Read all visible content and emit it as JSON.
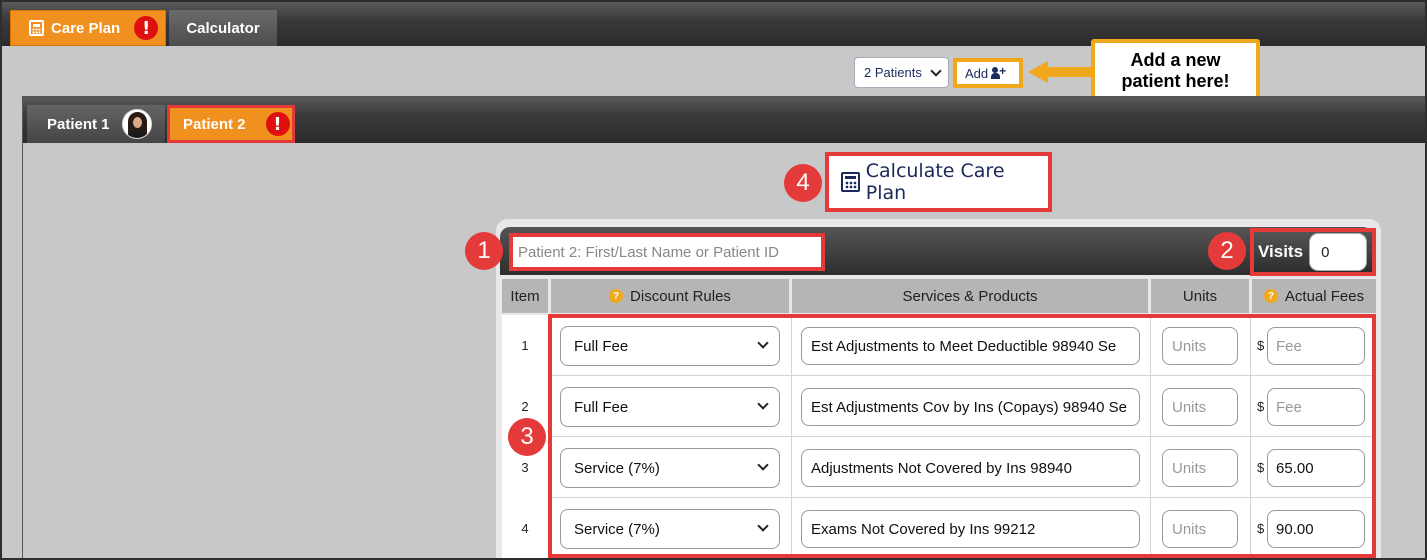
{
  "colors": {
    "accent_orange": "#f0901f",
    "highlight_red": "#e53a3a",
    "callout_yellow": "#f2a81d",
    "dark_bar": "#2d2d2d"
  },
  "top_tabs": [
    {
      "label": "Care Plan",
      "icon": "calculator-icon",
      "alert": "!"
    },
    {
      "label": "Calculator"
    }
  ],
  "patients_select": {
    "value": "2 Patients"
  },
  "add_button": {
    "label": "Add",
    "icon": "user-plus-icon"
  },
  "callout": {
    "line1": "Add a new",
    "line2": "patient here!"
  },
  "patient_tabs": [
    {
      "label": "Patient 1",
      "icon": "avatar"
    },
    {
      "label": "Patient 2",
      "alert": "!"
    }
  ],
  "calculate_button": {
    "label": "Calculate Care Plan",
    "icon": "calculator-icon"
  },
  "steps": [
    "1",
    "2",
    "3",
    "4"
  ],
  "patient_input": {
    "placeholder": "Patient 2: First/Last Name or Patient ID"
  },
  "visits": {
    "label": "Visits",
    "value": "0"
  },
  "table": {
    "headers": {
      "item": "Item",
      "rules": "Discount Rules",
      "services": "Services & Products",
      "units": "Units",
      "fees": "Actual Fees"
    },
    "rows": [
      {
        "item": "1",
        "rule": "Full Fee",
        "service": "Est Adjustments to Meet Deductible 98940 Se",
        "units": "Units",
        "fee": "Fee"
      },
      {
        "item": "2",
        "rule": "Full Fee",
        "service": "Est Adjustments Cov by Ins (Copays) 98940 Se",
        "units": "Units",
        "fee": "Fee"
      },
      {
        "item": "3",
        "rule": "Service (7%)",
        "service": "Adjustments Not Covered by Ins 98940",
        "units": "Units",
        "fee": "65.00"
      },
      {
        "item": "4",
        "rule": "Service (7%)",
        "service": "Exams Not Covered by Ins 99212",
        "units": "Units",
        "fee": "90.00"
      }
    ],
    "currency": "$"
  }
}
